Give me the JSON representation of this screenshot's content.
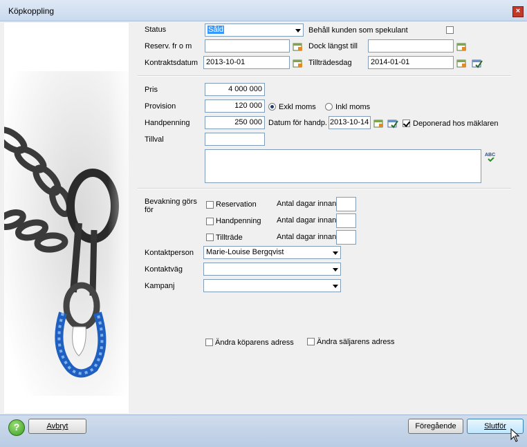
{
  "window": {
    "title": "Köpkoppling",
    "close_glyph": "×"
  },
  "status": {
    "label": "Status",
    "value": "Såld",
    "keep_customer_label": "Behåll kunden som spekulant",
    "keep_customer_checked": false
  },
  "reservation": {
    "label": "Reserv. fr o m",
    "value": "",
    "dock_label": "Dock längst till",
    "dock_value": ""
  },
  "contract": {
    "date_label": "Kontraktsdatum",
    "date_value": "2013-10-01",
    "access_label": "Tillträdesdag",
    "access_value": "2014-01-01"
  },
  "price": {
    "label": "Pris",
    "value": "4 000 000"
  },
  "commission": {
    "label": "Provision",
    "value": "120 000",
    "excl_label": "Exkl moms",
    "incl_label": "Inkl moms",
    "selected": "excl"
  },
  "deposit": {
    "label": "Handpenning",
    "value": "250 000",
    "date_label": "Datum för handp.",
    "date_value": "2013-10-14",
    "broker_label": "Deponerad hos mäklaren",
    "broker_checked": true
  },
  "extras": {
    "label": "Tillval",
    "value": "",
    "text": ""
  },
  "monitoring": {
    "label": "Bevakning görs för",
    "items": [
      {
        "label": "Reservation",
        "checked": false,
        "days_label": "Antal dagar innan",
        "days": ""
      },
      {
        "label": "Handpenning",
        "checked": false,
        "days_label": "Antal dagar innan",
        "days": ""
      },
      {
        "label": "Tillträde",
        "checked": false,
        "days_label": "Antal dagar innan",
        "days": ""
      }
    ]
  },
  "contact_person": {
    "label": "Kontaktperson",
    "value": "Marie-Louise Bergqvist"
  },
  "contact_route": {
    "label": "Kontaktväg",
    "value": ""
  },
  "campaign": {
    "label": "Kampanj",
    "value": ""
  },
  "address": {
    "buyer_label": "Ändra köparens adress",
    "buyer_checked": false,
    "seller_label": "Ändra säljarens adress",
    "seller_checked": false
  },
  "footer": {
    "help_glyph": "?",
    "cancel_label": "Avbryt",
    "previous_label": "Föregående",
    "finish_label": "Slutför"
  },
  "spellcheck_text": "ABC",
  "colors": {
    "accent": "#3399ff",
    "titlebar": "#c9d9ee",
    "bottombar": "#b9cce4"
  }
}
